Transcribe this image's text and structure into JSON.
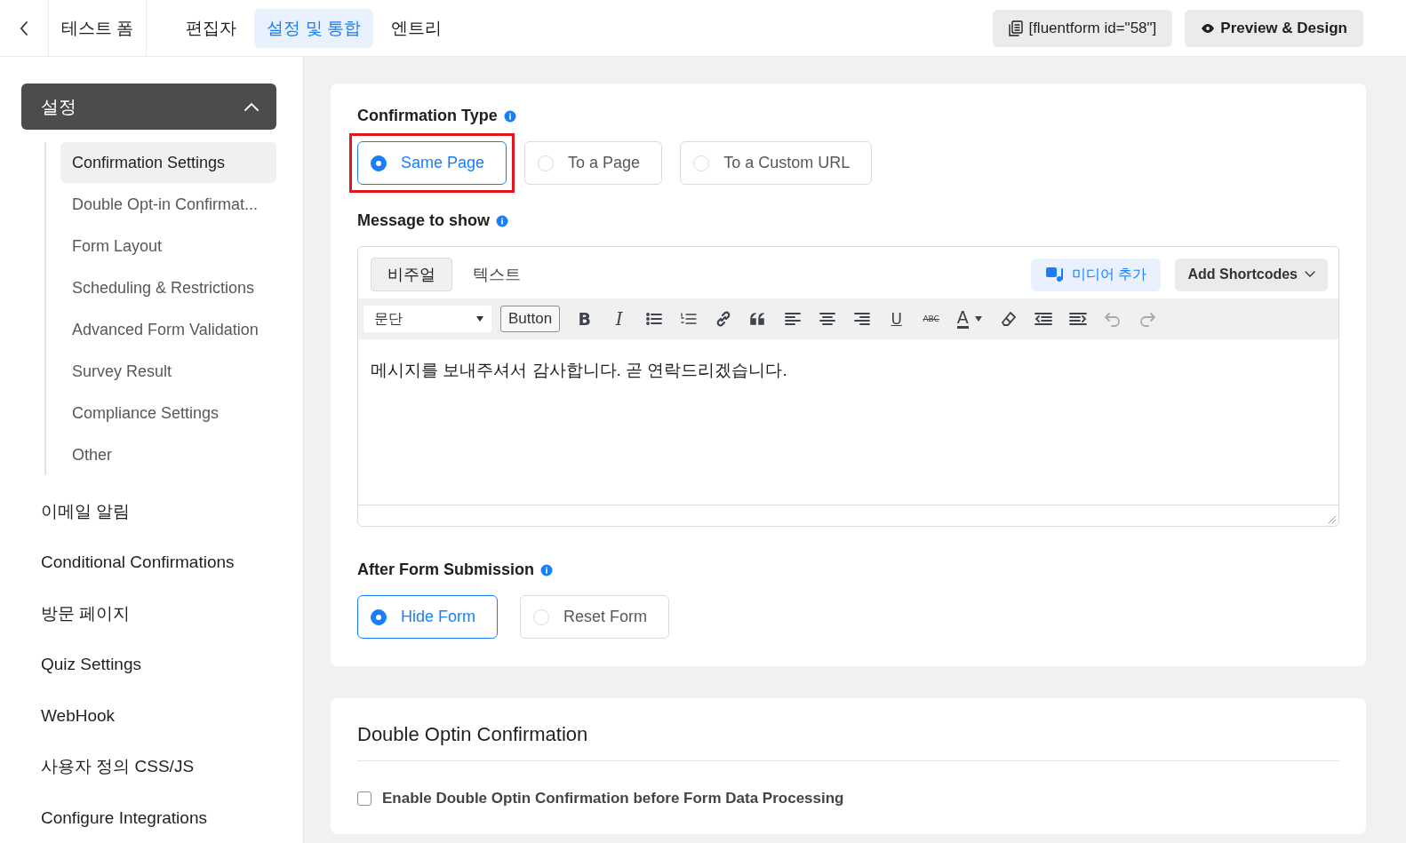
{
  "header": {
    "form_title": "테스트 폼",
    "tabs": [
      {
        "label": "편집자",
        "selected": false
      },
      {
        "label": "설정 및 통합",
        "selected": true
      },
      {
        "label": "엔트리",
        "selected": false
      }
    ],
    "shortcode": "[fluentform id=\"58\"]",
    "preview_button": "Preview & Design"
  },
  "sidebar": {
    "items": [
      {
        "label": "설정",
        "expanded": true,
        "children": [
          {
            "label": "Confirmation Settings",
            "selected": true
          },
          {
            "label": "Double Opt-in Confirmat...",
            "selected": false
          },
          {
            "label": "Form Layout",
            "selected": false
          },
          {
            "label": "Scheduling & Restrictions",
            "selected": false
          },
          {
            "label": "Advanced Form Validation",
            "selected": false
          },
          {
            "label": "Survey Result",
            "selected": false
          },
          {
            "label": "Compliance Settings",
            "selected": false
          },
          {
            "label": "Other",
            "selected": false
          }
        ]
      },
      {
        "label": "이메일 알림",
        "selected": false
      },
      {
        "label": "Conditional Confirmations",
        "selected": false
      },
      {
        "label": "방문 페이지",
        "selected": false
      },
      {
        "label": "Quiz Settings",
        "selected": false
      },
      {
        "label": "WebHook",
        "selected": false
      },
      {
        "label": "사용자 정의 CSS/JS",
        "selected": false
      },
      {
        "label": "Configure Integrations",
        "selected": false
      }
    ]
  },
  "confirmation": {
    "type_label": "Confirmation Type",
    "type_options": [
      {
        "label": "Same Page",
        "selected": true,
        "highlighted": true
      },
      {
        "label": "To a Page",
        "selected": false,
        "highlighted": false
      },
      {
        "label": "To a Custom URL",
        "selected": false,
        "highlighted": false
      }
    ],
    "message_label": "Message to show",
    "editor": {
      "tabs": [
        {
          "label": "비주얼",
          "selected": true
        },
        {
          "label": "텍스트",
          "selected": false
        }
      ],
      "media_button": "미디어 추가",
      "shortcodes_button": "Add Shortcodes",
      "format_select": "문단",
      "toolbar": [
        {
          "kind": "button",
          "text": "Button"
        },
        {
          "kind": "bold",
          "glyph": "B"
        },
        {
          "kind": "italic",
          "glyph": "I"
        },
        {
          "kind": "bullet-list"
        },
        {
          "kind": "numbered-list"
        },
        {
          "kind": "link"
        },
        {
          "kind": "quote"
        },
        {
          "kind": "align-left"
        },
        {
          "kind": "align-center"
        },
        {
          "kind": "align-right"
        },
        {
          "kind": "underline",
          "glyph": "U"
        },
        {
          "kind": "strikethrough",
          "glyph": "ABC"
        },
        {
          "kind": "text-color",
          "glyph": "A"
        },
        {
          "kind": "eraser"
        },
        {
          "kind": "outdent"
        },
        {
          "kind": "indent"
        },
        {
          "kind": "undo",
          "disabled": true
        },
        {
          "kind": "redo",
          "disabled": true
        }
      ],
      "content": "메시지를 보내주셔서 감사합니다. 곧 연락드리겠습니다."
    },
    "after_label": "After Form Submission",
    "after_options": [
      {
        "label": "Hide Form",
        "selected": true
      },
      {
        "label": "Reset Form",
        "selected": false
      }
    ]
  },
  "double_optin": {
    "title": "Double Optin Confirmation",
    "checkbox": {
      "label": "Enable Double Optin Confirmation before Form Data Processing",
      "checked": false
    }
  }
}
